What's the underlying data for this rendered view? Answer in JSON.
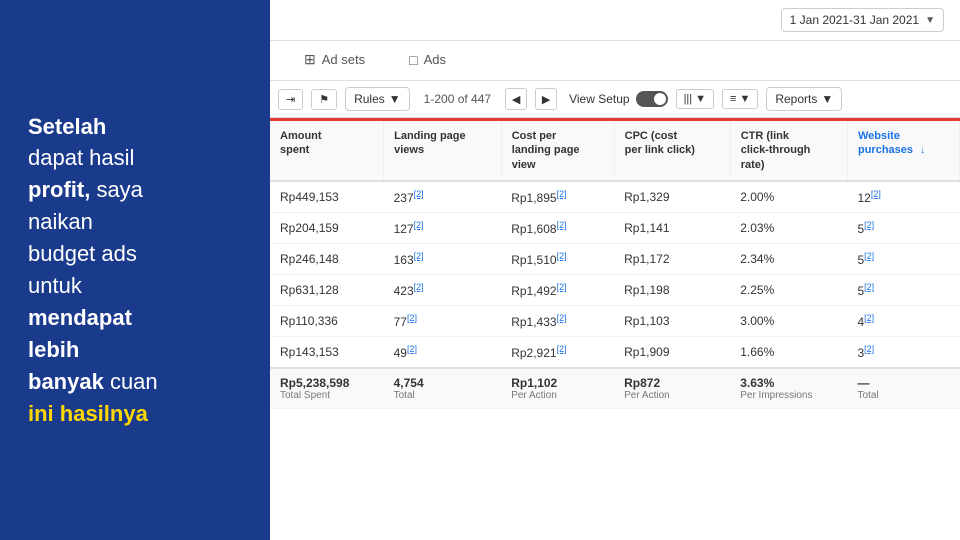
{
  "leftPanel": {
    "line1": "Setelah",
    "line2": "dapat hasil",
    "line3bold": "profit,",
    "line3rest": " saya",
    "line4": "naikan",
    "line5": "budget ads",
    "line6": "untuk",
    "line7bold": "mendapat",
    "line8bold": "lebih",
    "line9bold": "banyak",
    "line9rest": " cuan",
    "line10yellow": "ini hasilnya"
  },
  "topBar": {
    "dateRange": "1 Jan 2021-31 Jan 2021",
    "arrow": "▼"
  },
  "tabs": [
    {
      "id": "adsets",
      "label": "Ad sets",
      "icon": "⊞",
      "active": false
    },
    {
      "id": "ads",
      "label": "Ads",
      "icon": "□",
      "active": false
    }
  ],
  "toolbar": {
    "filterIcon": "⇥",
    "flagIcon": "⚑",
    "rulesLabel": "Rules",
    "rulesArrow": "▼",
    "paginationInfo": "1-200 of 447",
    "viewSetupLabel": "View Setup",
    "reportsLabel": "Reports",
    "reportsArrow": "▼"
  },
  "table": {
    "columns": [
      {
        "id": "amount-spent",
        "label": "Amount spent",
        "subLabel": "",
        "active": false
      },
      {
        "id": "landing-page-views",
        "label": "Landing page views",
        "subLabel": "",
        "active": false
      },
      {
        "id": "cost-per-landing-page-view",
        "label": "Cost per landing page view",
        "subLabel": "",
        "active": false
      },
      {
        "id": "cpc",
        "label": "CPC (cost per link click)",
        "subLabel": "",
        "active": false
      },
      {
        "id": "ctr",
        "label": "CTR (link click-through rate)",
        "subLabel": "",
        "active": false
      },
      {
        "id": "website-purchases",
        "label": "Website purchases",
        "subLabel": "",
        "active": true
      }
    ],
    "rows": [
      {
        "amountSpent": "Rp449,153",
        "landingPageViews": "237",
        "costPerLPV": "Rp1,895",
        "cpc": "Rp1,329",
        "ctr": "2.00%",
        "websitePurchases": "12"
      },
      {
        "amountSpent": "Rp204,159",
        "landingPageViews": "127",
        "costPerLPV": "Rp1,608",
        "cpc": "Rp1,141",
        "ctr": "2.03%",
        "websitePurchases": "5"
      },
      {
        "amountSpent": "Rp246,148",
        "landingPageViews": "163",
        "costPerLPV": "Rp1,510",
        "cpc": "Rp1,172",
        "ctr": "2.34%",
        "websitePurchases": "5"
      },
      {
        "amountSpent": "Rp631,128",
        "landingPageViews": "423",
        "costPerLPV": "Rp1,492",
        "cpc": "Rp1,198",
        "ctr": "2.25%",
        "websitePurchases": "5"
      },
      {
        "amountSpent": "Rp110,336",
        "landingPageViews": "77",
        "costPerLPV": "Rp1,433",
        "cpc": "Rp1,103",
        "ctr": "3.00%",
        "websitePurchases": "4"
      },
      {
        "amountSpent": "Rp143,153",
        "landingPageViews": "49",
        "costPerLPV": "Rp2,921",
        "cpc": "Rp1,909",
        "ctr": "1.66%",
        "websitePurchases": "3"
      }
    ],
    "totalRow": {
      "amountSpent": "Rp5,238,598",
      "amountSpentSub": "Total Spent",
      "landingPageViews": "4,754",
      "landingPageViewsSub": "Total",
      "costPerLPV": "Rp1,102",
      "costPerLPVSub": "Per Action",
      "cpc": "Rp872",
      "cpcSub": "Per Action",
      "ctr": "3.63%",
      "ctrSub": "Per Impressions",
      "websitePurchases": "—",
      "websitePurchasesSub": "Total"
    }
  },
  "colors": {
    "accent": "#1a73e8",
    "red": "#e53935",
    "leftBg": "#1a3a8c",
    "yellow": "#FFD700"
  }
}
